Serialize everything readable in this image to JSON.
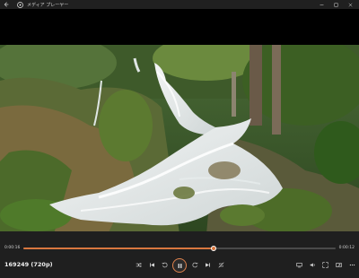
{
  "window": {
    "title": "メディア プレーヤー",
    "controls": [
      "minimize",
      "maximize",
      "close"
    ]
  },
  "player": {
    "current_time": "0:00:16",
    "duration": "0:00:12",
    "progress": 0.61,
    "media_title": "169249 (720p)",
    "state": "playing",
    "accent_color": "#d9773f"
  },
  "icons": {
    "back": "back-arrow-icon",
    "app": "media-player-icon",
    "shuffle": "shuffle-icon",
    "previous": "previous-track-icon",
    "rewind": "rewind-10-icon",
    "pause": "pause-icon",
    "forward": "forward-30-icon",
    "next": "next-track-icon",
    "repeat": "repeat-off-icon",
    "cast": "cast-to-device-icon",
    "volume": "volume-icon",
    "fullscreen": "fullscreen-icon",
    "miniplayer": "mini-player-icon",
    "more": "more-options-icon"
  }
}
